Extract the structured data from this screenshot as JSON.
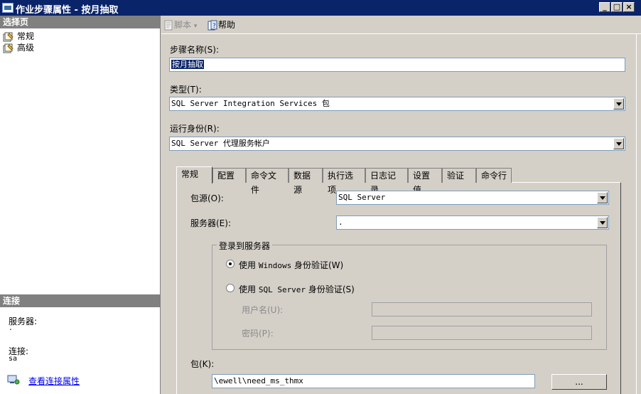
{
  "window": {
    "title": "作业步骤属性 - 按月抽取"
  },
  "left": {
    "select_page_header": "选择页",
    "pages": [
      {
        "label": "常规",
        "icon": "page-icon"
      },
      {
        "label": "高级",
        "icon": "page-icon"
      }
    ],
    "connection_header": "连接",
    "server_label": "服务器:",
    "server_value": ".",
    "connection_label": "连接:",
    "connection_value": "sa",
    "view_connection_link": "查看连接属性"
  },
  "toolbar": {
    "script_label": "脚本",
    "help_label": "帮助"
  },
  "form": {
    "step_name_label": "步骤名称(S):",
    "step_name_value": "按月抽取",
    "type_label": "类型(T):",
    "type_value": "SQL Server Integration Services 包",
    "run_as_label": "运行身份(R):",
    "run_as_value": "SQL Server 代理服务帐户"
  },
  "tabs": [
    "常规",
    "配置",
    "命令文件",
    "数据源",
    "执行选项",
    "日志记录",
    "设置值",
    "验证",
    "命令行"
  ],
  "general": {
    "package_source_label": "包源(O):",
    "package_source_value": "SQL Server",
    "server_label": "服务器(E):",
    "server_value": ".",
    "login_group_label": "登录到服务器",
    "windows_auth_prefix": "使用 ",
    "windows_auth_mono": "Windows",
    "windows_auth_suffix": " 身份验证(W)",
    "sql_auth_prefix": "使用 ",
    "sql_auth_mono": "SQL Server",
    "sql_auth_suffix": " 身份验证(S)",
    "username_label": "用户名(U):",
    "username_value": "",
    "password_label": "密码(P):",
    "password_value": "",
    "package_label": "包(K):",
    "package_value": "\\ewell\\need_ms_thmx",
    "browse_label": "..."
  }
}
